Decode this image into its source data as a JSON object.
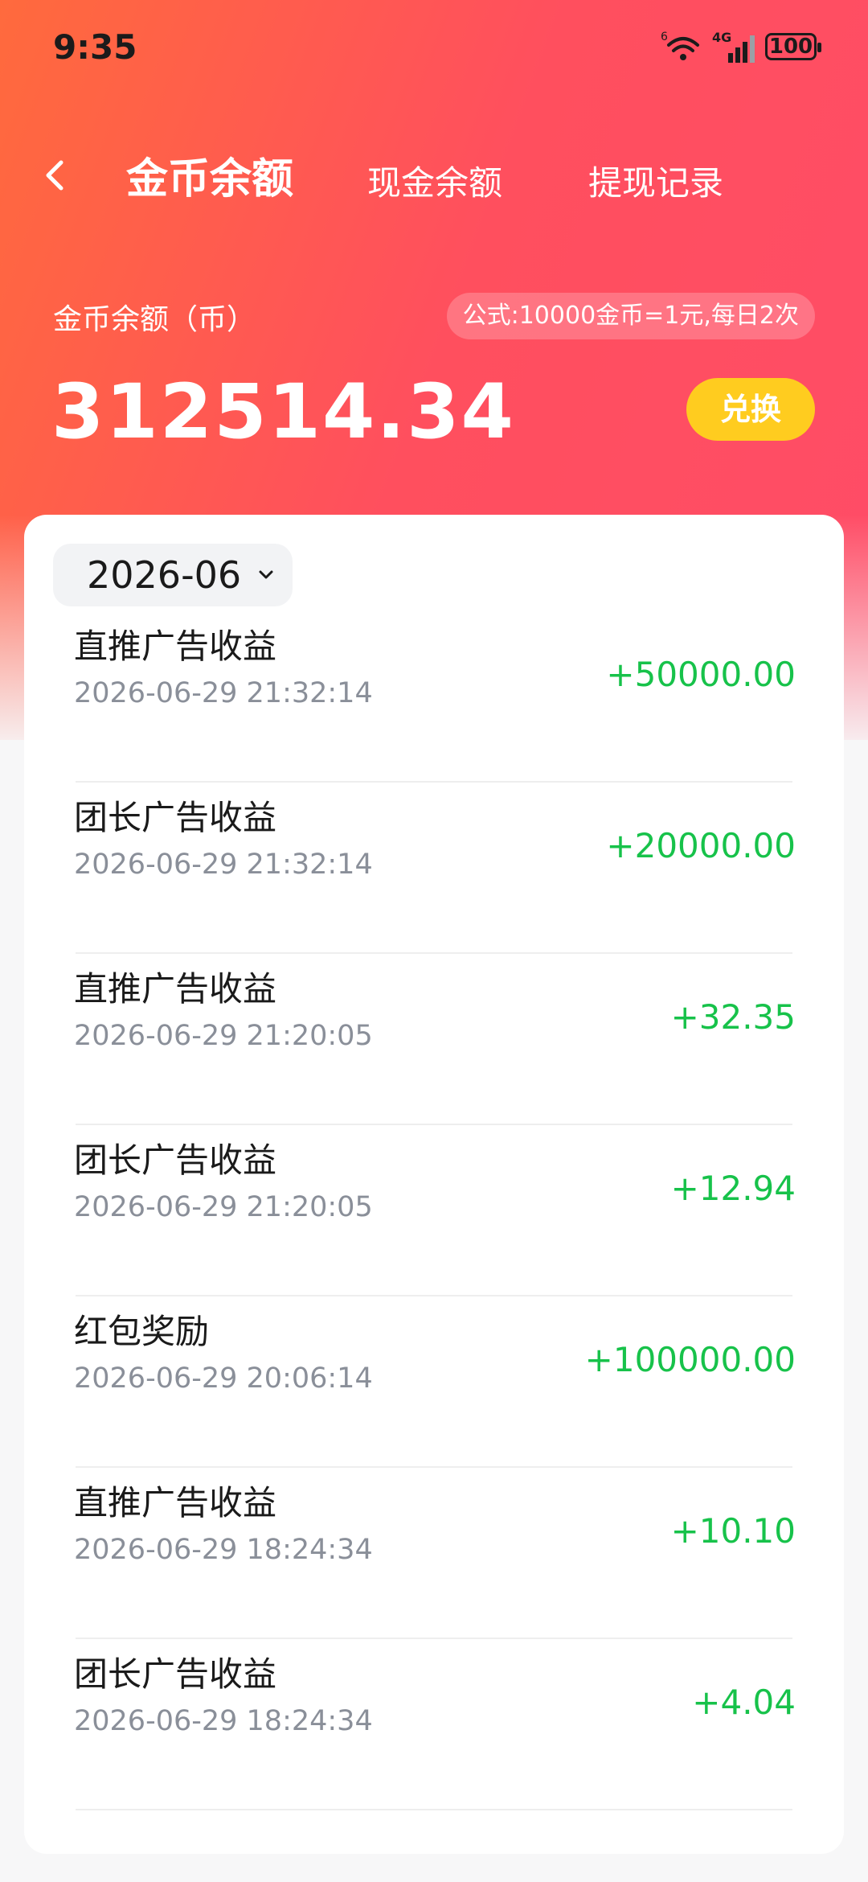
{
  "status_bar": {
    "time": "9:35",
    "network": "4G",
    "battery": "100",
    "icons": [
      "wifi-icon",
      "signal-icon",
      "battery-icon"
    ]
  },
  "nav": {
    "tabs": [
      {
        "label": "金币余额",
        "active": true
      },
      {
        "label": "现金余额",
        "active": false
      },
      {
        "label": "提现记录",
        "active": false
      }
    ]
  },
  "balance": {
    "label": "金币余额（币）",
    "formula": "公式:10000金币=1元,每日2次",
    "value": "312514.34",
    "exchange_label": "兑换"
  },
  "filter": {
    "month": "2026-06"
  },
  "records": [
    {
      "title": "直推广告收益",
      "time": "2026-06-29 21:32:14",
      "amount": "+50000.00"
    },
    {
      "title": "团长广告收益",
      "time": "2026-06-29 21:32:14",
      "amount": "+20000.00"
    },
    {
      "title": "直推广告收益",
      "time": "2026-06-29 21:20:05",
      "amount": "+32.35"
    },
    {
      "title": "团长广告收益",
      "time": "2026-06-29 21:20:05",
      "amount": "+12.94"
    },
    {
      "title": "红包奖励",
      "time": "2026-06-29 20:06:14",
      "amount": "+100000.00"
    },
    {
      "title": "直推广告收益",
      "time": "2026-06-29 18:24:34",
      "amount": "+10.10"
    },
    {
      "title": "团长广告收益",
      "time": "2026-06-29 18:24:34",
      "amount": "+4.04"
    }
  ],
  "colors": {
    "gradient_start": "#ff6a3d",
    "gradient_end": "#ff4c67",
    "exchange_button": "#ffcc1f",
    "amount_positive": "#17c24a"
  }
}
